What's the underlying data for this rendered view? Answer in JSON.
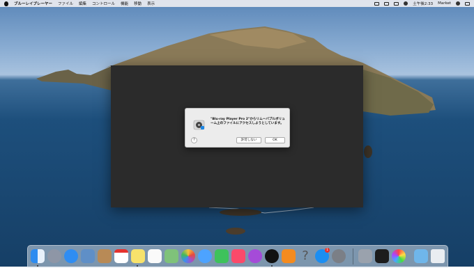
{
  "menubar": {
    "app_name": "ブルーレイプレーヤー",
    "items": [
      "ファイル",
      "編集",
      "コントロール",
      "機能",
      "移動",
      "表示"
    ],
    "clock": "土午後2:33",
    "user": "Market"
  },
  "dialog": {
    "message": "\"Blu-ray Player Pro 2\"からリムーバブルボリューム上のファイルにアクセスしようとしています。",
    "help_label": "?",
    "deny_label": "許可しない",
    "ok_label": "OK"
  },
  "dock": {
    "badge_count": "1",
    "apps": [
      "finder-icon",
      "launchpad-icon",
      "safari-icon",
      "preview-icon",
      "contacts-icon",
      "calendar-icon",
      "notes-icon",
      "reminders-icon",
      "maps-icon",
      "photos-icon",
      "messages-icon",
      "facetime-icon",
      "music-icon",
      "podcasts-icon",
      "tv-icon",
      "books-icon",
      "help-icon",
      "app-store-icon",
      "system-preferences-icon",
      "utility-icon",
      "terminal-icon",
      "color-picker-icon",
      "downloads-folder-icon",
      "trash-icon"
    ],
    "dock_label": ""
  },
  "colors": {
    "window": "#2b2b2b",
    "dialog": "#ececec",
    "accent": "#1a73e8"
  }
}
